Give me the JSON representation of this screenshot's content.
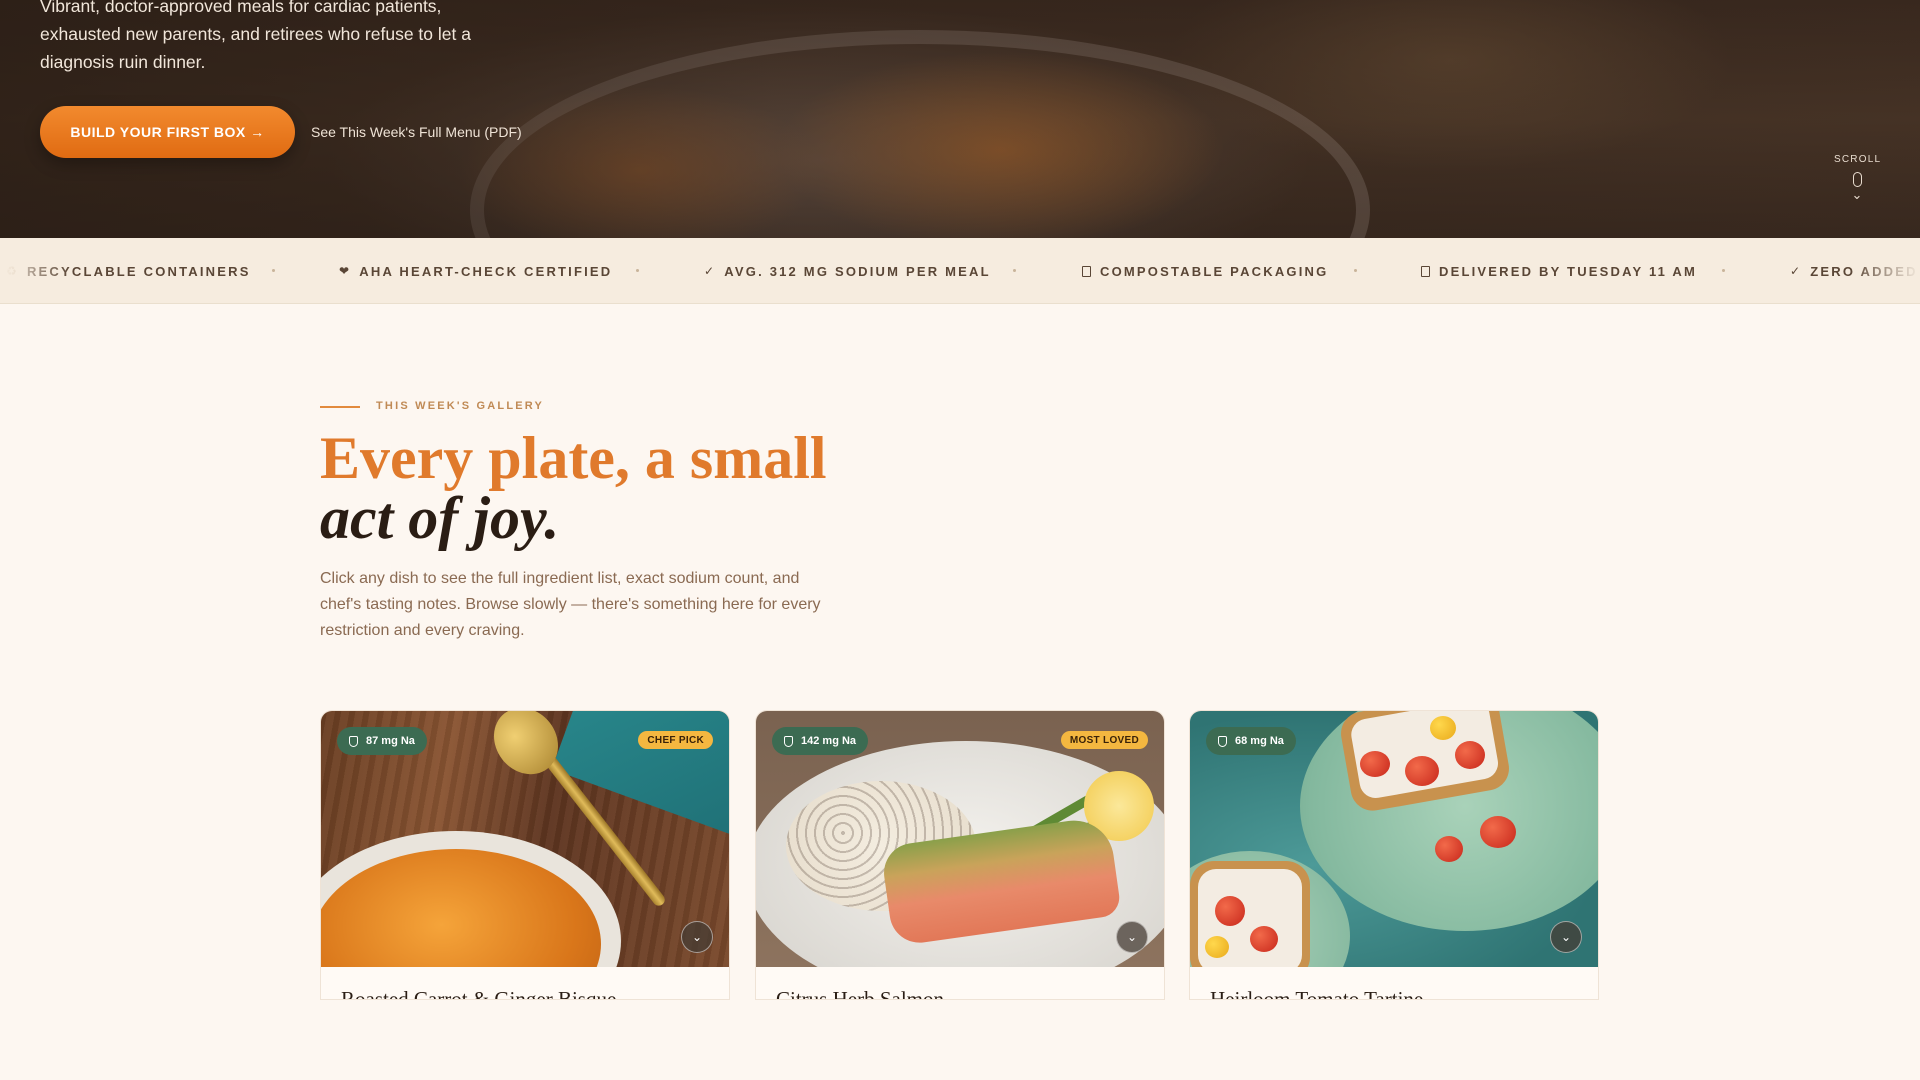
{
  "hero": {
    "subtitle": "Vibrant, doctor-approved meals for cardiac patients, exhausted new parents, and retirees who refuse to let a diagnosis ruin dinner.",
    "cta_label": "BUILD YOUR FIRST BOX →",
    "menu_link": "See This Week's Full Menu (PDF)",
    "scroll_label": "SCROLL"
  },
  "ticker": {
    "items": [
      {
        "icon": "recycle-icon",
        "text": "RECYCLABLE CONTAINERS"
      },
      {
        "icon": "heart-icon",
        "text": "AHA HEART-CHECK CERTIFIED"
      },
      {
        "icon": "check-icon",
        "text": "AVG. 312 MG SODIUM PER MEAL"
      },
      {
        "icon": "box-icon",
        "text": "COMPOSTABLE PACKAGING"
      },
      {
        "icon": "box-icon",
        "text": "DELIVERED BY TUESDAY 11 AM"
      },
      {
        "icon": "check-icon",
        "text": "ZERO ADDED"
      }
    ]
  },
  "gallery": {
    "eyebrow": "THIS WEEK'S GALLERY",
    "headline_line1": "Every plate, a small",
    "headline_line2": "act of joy.",
    "intro": "Click any dish to see the full ingredient list, exact sodium count, and chef's tasting notes. Browse slowly — there's something here for every restriction and every craving.",
    "cards": [
      {
        "sodium": "87 mg Na",
        "tag": "CHEF PICK",
        "title": "Roasted Carrot & Ginger Bisque"
      },
      {
        "sodium": "142 mg Na",
        "tag": "MOST LOVED",
        "title": "Citrus Herb Salmon"
      },
      {
        "sodium": "68 mg Na",
        "tag": "",
        "title": "Heirloom Tomato Tartine"
      }
    ]
  },
  "colors": {
    "accent": "#e07a2c",
    "sodium_badge": "#3c6b52",
    "tag_badge": "#f4b740",
    "background": "#fdf7f1"
  }
}
